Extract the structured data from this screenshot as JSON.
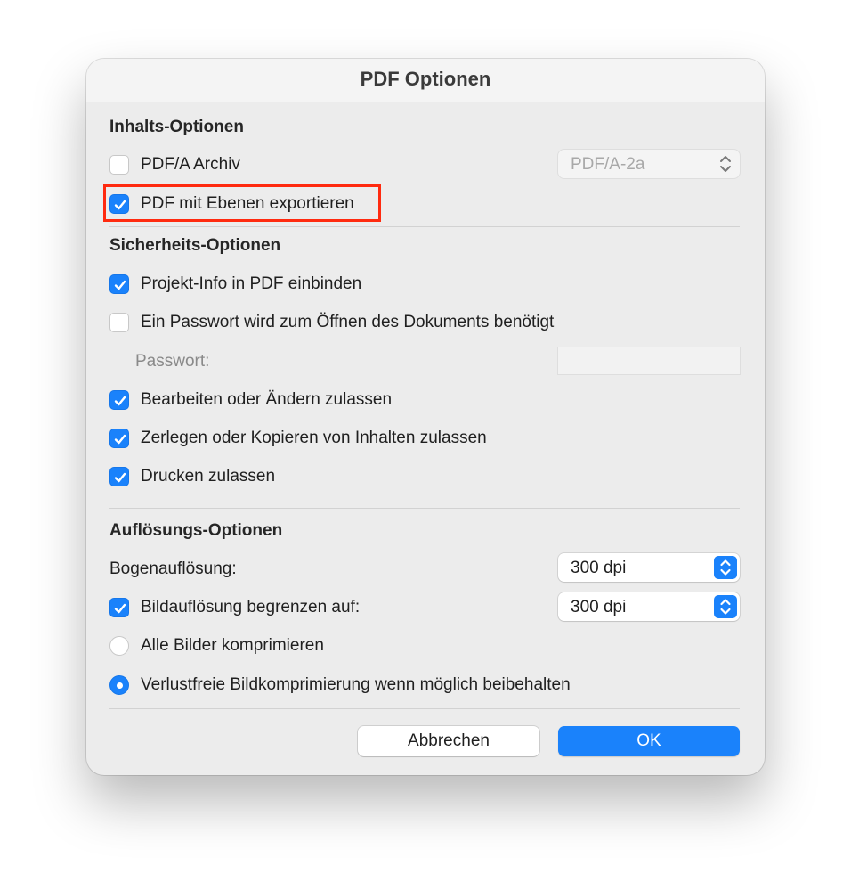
{
  "dialog": {
    "title": "PDF Optionen"
  },
  "content_options": {
    "heading": "Inhalts-Optionen",
    "pdfa_archive": {
      "label": "PDF/A Archiv",
      "checked": false
    },
    "pdfa_select": {
      "value": "PDF/A-2a",
      "enabled": false
    },
    "export_layers": {
      "label": "PDF mit Ebenen exportieren",
      "checked": true
    }
  },
  "security_options": {
    "heading": "Sicherheits-Optionen",
    "project_info": {
      "label": "Projekt-Info in PDF einbinden",
      "checked": true
    },
    "password_required": {
      "label": "Ein Passwort wird zum Öffnen des Dokuments benötigt",
      "checked": false
    },
    "password_label": "Passwort:",
    "password_value": "",
    "allow_edit": {
      "label": "Bearbeiten oder Ändern zulassen",
      "checked": true
    },
    "allow_copy": {
      "label": "Zerlegen oder Kopieren von Inhalten zulassen",
      "checked": true
    },
    "allow_print": {
      "label": "Drucken zulassen",
      "checked": true
    }
  },
  "resolution_options": {
    "heading": "Auflösungs-Optionen",
    "sheet_resolution_label": "Bogenauflösung:",
    "sheet_resolution_value": "300 dpi",
    "limit_image_resolution": {
      "label": "Bildauflösung begrenzen auf:",
      "checked": true
    },
    "image_resolution_value": "300 dpi",
    "compress_all": {
      "label": "Alle Bilder komprimieren",
      "selected": false
    },
    "lossless_keep": {
      "label": "Verlustfreie Bildkomprimierung wenn möglich beibehalten",
      "selected": true
    }
  },
  "buttons": {
    "cancel": "Abbrechen",
    "ok": "OK"
  },
  "colors": {
    "accent": "#1a82fb",
    "highlight": "#ff2a0f",
    "dialog_bg": "#ececec"
  }
}
